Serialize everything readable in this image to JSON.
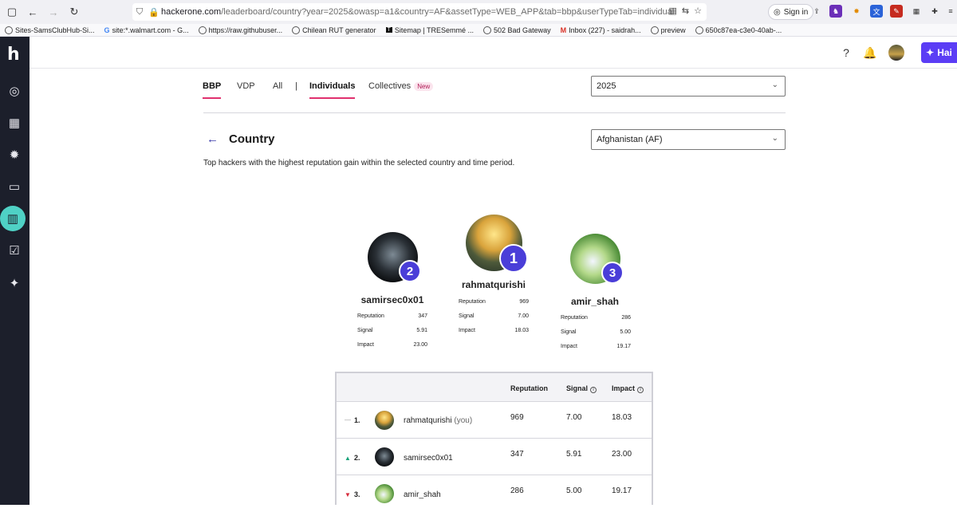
{
  "browser": {
    "url_host": "hackerone.com",
    "url_path": "/leaderboard/country?year=2025&owasp=a1&country=AF&assetType=WEB_APP&tab=bbp&userTypeTab=individual",
    "signin_label": "Sign in",
    "bookmarks": [
      "Sites-SamsClubHub-Si...",
      "site:*.walmart.com - G...",
      "https://raw.githubuser...",
      "Chilean RUT generator",
      "Sitemap | TRESemmé ...",
      "502 Bad Gateway",
      "Inbox (227) - saidrah...",
      "preview",
      "650c87ea-c3e0-40ab-..."
    ]
  },
  "app": {
    "hai_label": "Hai"
  },
  "tabs": {
    "bbp": "BBP",
    "vdp": "VDP",
    "all": "All",
    "individuals": "Individuals",
    "collectives": "Collectives",
    "new_badge": "New"
  },
  "filters": {
    "year": "2025",
    "country": "Afghanistan (AF)"
  },
  "page": {
    "title": "Country",
    "description": "Top hackers with the highest reputation gain within the selected country and time period."
  },
  "stat_labels": {
    "reputation": "Reputation",
    "signal": "Signal",
    "impact": "Impact"
  },
  "podium": {
    "first": {
      "rank": "1",
      "name": "rahmatqurishi",
      "reputation": "969",
      "signal": "7.00",
      "impact": "18.03"
    },
    "second": {
      "rank": "2",
      "name": "samirsec0x01",
      "reputation": "347",
      "signal": "5.91",
      "impact": "23.00"
    },
    "third": {
      "rank": "3",
      "name": "amir_shah",
      "reputation": "286",
      "signal": "5.00",
      "impact": "19.17"
    }
  },
  "table": {
    "headers": {
      "reputation": "Reputation",
      "signal": "Signal",
      "impact": "Impact"
    },
    "rows": [
      {
        "rank": "1.",
        "name": "rahmatqurishi",
        "you": "(you)",
        "reputation": "969",
        "signal": "7.00",
        "impact": "18.03",
        "trend": "—"
      },
      {
        "rank": "2.",
        "name": "samirsec0x01",
        "you": "",
        "reputation": "347",
        "signal": "5.91",
        "impact": "23.00",
        "trend": "▲"
      },
      {
        "rank": "3.",
        "name": "amir_shah",
        "you": "",
        "reputation": "286",
        "signal": "5.00",
        "impact": "19.17",
        "trend": "▼"
      }
    ]
  },
  "colors": {
    "accent": "#4a3ed8",
    "tab_underline": "#e0306e",
    "sidebar": "#1c1f2b",
    "active_nav": "#4fd1c5",
    "trend_up": "#1aa37a",
    "trend_down": "#d62b3b"
  }
}
